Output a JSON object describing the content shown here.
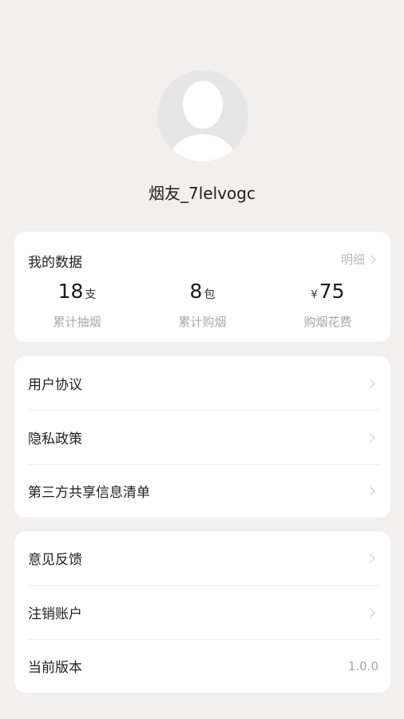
{
  "profile": {
    "nickname": "烟友_7lelvogc"
  },
  "my_data": {
    "title": "我的数据",
    "detail_label": "明细",
    "stats": [
      {
        "prefix": "",
        "value": "18",
        "unit": "支",
        "label": "累计抽烟"
      },
      {
        "prefix": "",
        "value": "8",
        "unit": "包",
        "label": "累计购烟"
      },
      {
        "prefix": "¥",
        "value": "75",
        "unit": "",
        "label": "购烟花费"
      }
    ]
  },
  "menu_group_1": [
    {
      "label": "用户协议"
    },
    {
      "label": "隐私政策"
    },
    {
      "label": "第三方共享信息清单"
    }
  ],
  "menu_group_2": [
    {
      "label": "意见反馈"
    },
    {
      "label": "注销账户"
    },
    {
      "label": "当前版本",
      "value": "1.0.0"
    }
  ],
  "colors": {
    "background": "#f2f0ec",
    "card": "#ffffff",
    "muted_text": "#a8a8a8"
  },
  "icons": [
    "avatar-placeholder-icon",
    "chevron-right-icon"
  ]
}
